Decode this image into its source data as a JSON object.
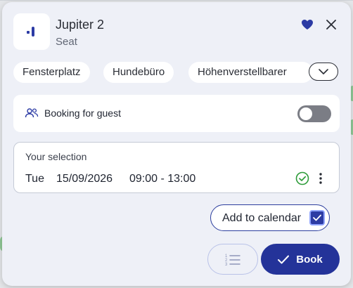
{
  "header": {
    "title": "Jupiter 2",
    "subtitle": "Seat",
    "favorite_icon": "heart-icon",
    "close_icon": "close-icon"
  },
  "chips": {
    "items": [
      "Fensterplatz",
      "Hundebüro",
      "Höhenverstellbarer"
    ],
    "expand_icon": "chevron-down-icon"
  },
  "guest": {
    "label": "Booking for guest",
    "icon": "people-icon",
    "enabled": false
  },
  "selection": {
    "label": "Your selection",
    "day": "Tue",
    "date": "15/09/2026",
    "time": "09:00 - 13:00",
    "status_icon": "check-circle-icon",
    "menu_icon": "more-vertical-icon"
  },
  "calendar": {
    "label": "Add to calendar",
    "checked": true
  },
  "actions": {
    "list_icon": "numbered-list-icon",
    "book_label": "Book"
  },
  "colors": {
    "accent": "#243399",
    "panel": "#eef0f7",
    "success": "#2e9c3a"
  }
}
